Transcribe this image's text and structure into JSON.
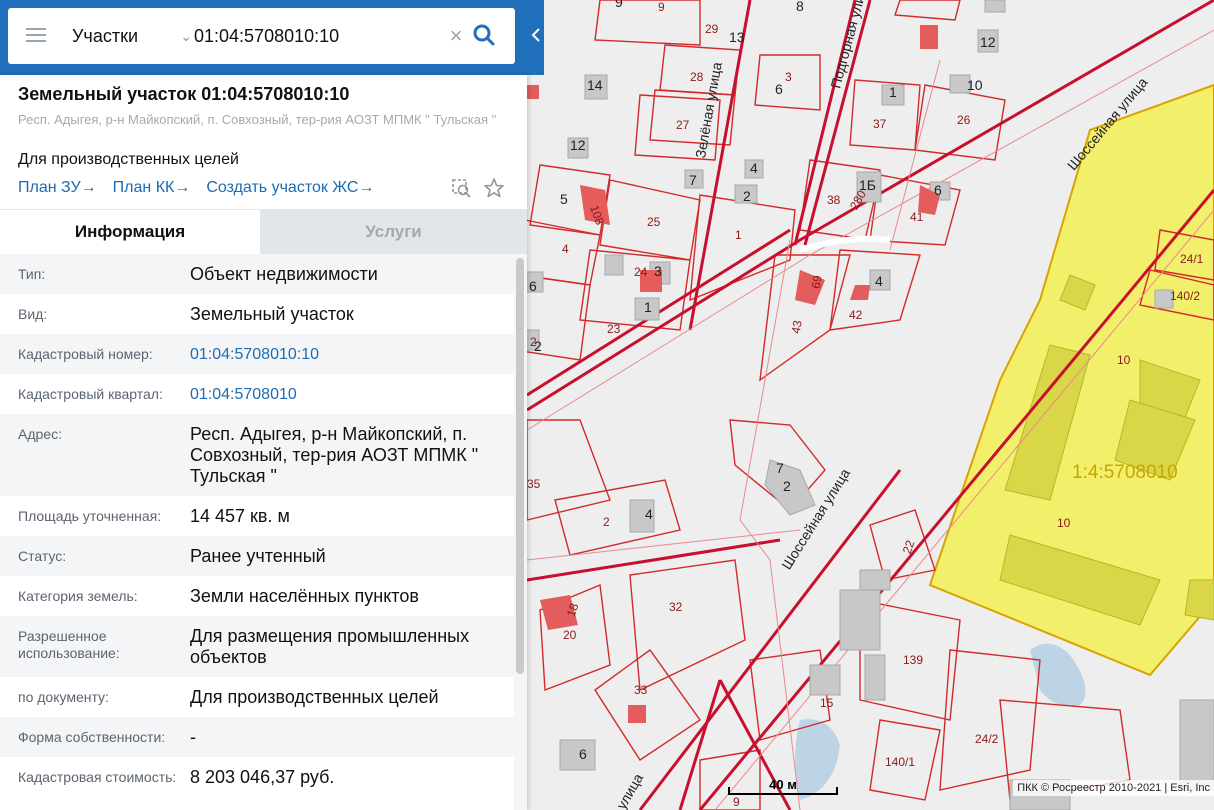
{
  "search": {
    "type_label": "Участки",
    "query": "01:04:5708010:10"
  },
  "object": {
    "title": "Земельный участок 01:04:5708010:10",
    "address": "Респ. Адыгея, р-н Майкопский, п. Совхозный, тер-рия АОЗТ МПМК \" Тульская \"",
    "purpose": "Для производственных целей"
  },
  "links": {
    "plan_zu": "План ЗУ",
    "plan_kk": "План КК",
    "create_zs": "Создать участок ЖС",
    "arrow": "→"
  },
  "tabs": {
    "info": "Информация",
    "services": "Услуги"
  },
  "info": [
    {
      "label": "Тип:",
      "value": "Объект недвижимости"
    },
    {
      "label": "Вид:",
      "value": "Земельный участок"
    },
    {
      "label": "Кадастровый номер:",
      "value": "01:04:5708010:10"
    },
    {
      "label": "Кадастровый квартал:",
      "value": "01:04:5708010"
    },
    {
      "label": "Адрес:",
      "value": "Респ. Адыгея, р-н Майкопский, п. Совхозный, тер-рия АОЗТ МПМК \" Тульская \""
    },
    {
      "label": "Площадь уточненная:",
      "value": "14 457 кв. м"
    },
    {
      "label": "Статус:",
      "value": "Ранее учтенный"
    },
    {
      "label": "Категория земель:",
      "value": "Земли населённых пунктов"
    },
    {
      "label": "Разрешенное использование:",
      "value": "Для размещения промышленных объектов"
    },
    {
      "label": "по документу:",
      "value": "Для производственных целей"
    },
    {
      "label": "Форма собственности:",
      "value": "-"
    },
    {
      "label": "Кадастровая стоимость:",
      "value": "8 203 046,37 руб."
    }
  ],
  "map": {
    "streets": [
      "Зелёная улица",
      "Подгорная улица",
      "Шоссейная улица",
      "Шоссейная улица",
      "улица"
    ],
    "cadastral_overlay": "1:4:5708010",
    "scale_label": "40 м",
    "attribution": "ПКК © Росреестр 2010-2021 | Esri, Inc",
    "parcel_labels": [
      "29",
      "28",
      "27",
      "3",
      "37",
      "26",
      "25",
      "108",
      "4",
      "24",
      "23",
      "38",
      "280",
      "41",
      "69",
      "42",
      "43",
      "2",
      "1",
      "33",
      "32",
      "20",
      "18",
      "35",
      "2",
      "22",
      "139",
      "15",
      "24/2",
      "140/1",
      "24/1",
      "140/2",
      "10",
      "10",
      "9",
      "9",
      "6"
    ],
    "building_numbers": [
      "9",
      "8",
      "13",
      "14",
      "12",
      "6",
      "1",
      "12",
      "10",
      "4",
      "7",
      "2",
      "5",
      "1Б",
      "6",
      "3",
      "1",
      "6",
      "4",
      "2",
      "7",
      "2",
      "4",
      "6",
      "2"
    ],
    "colors": {
      "parcel_line": "#d22a2a",
      "selected_fill": "#f2ef5c",
      "building": "#c8c8c8",
      "red_building": "#e45c5c"
    }
  }
}
